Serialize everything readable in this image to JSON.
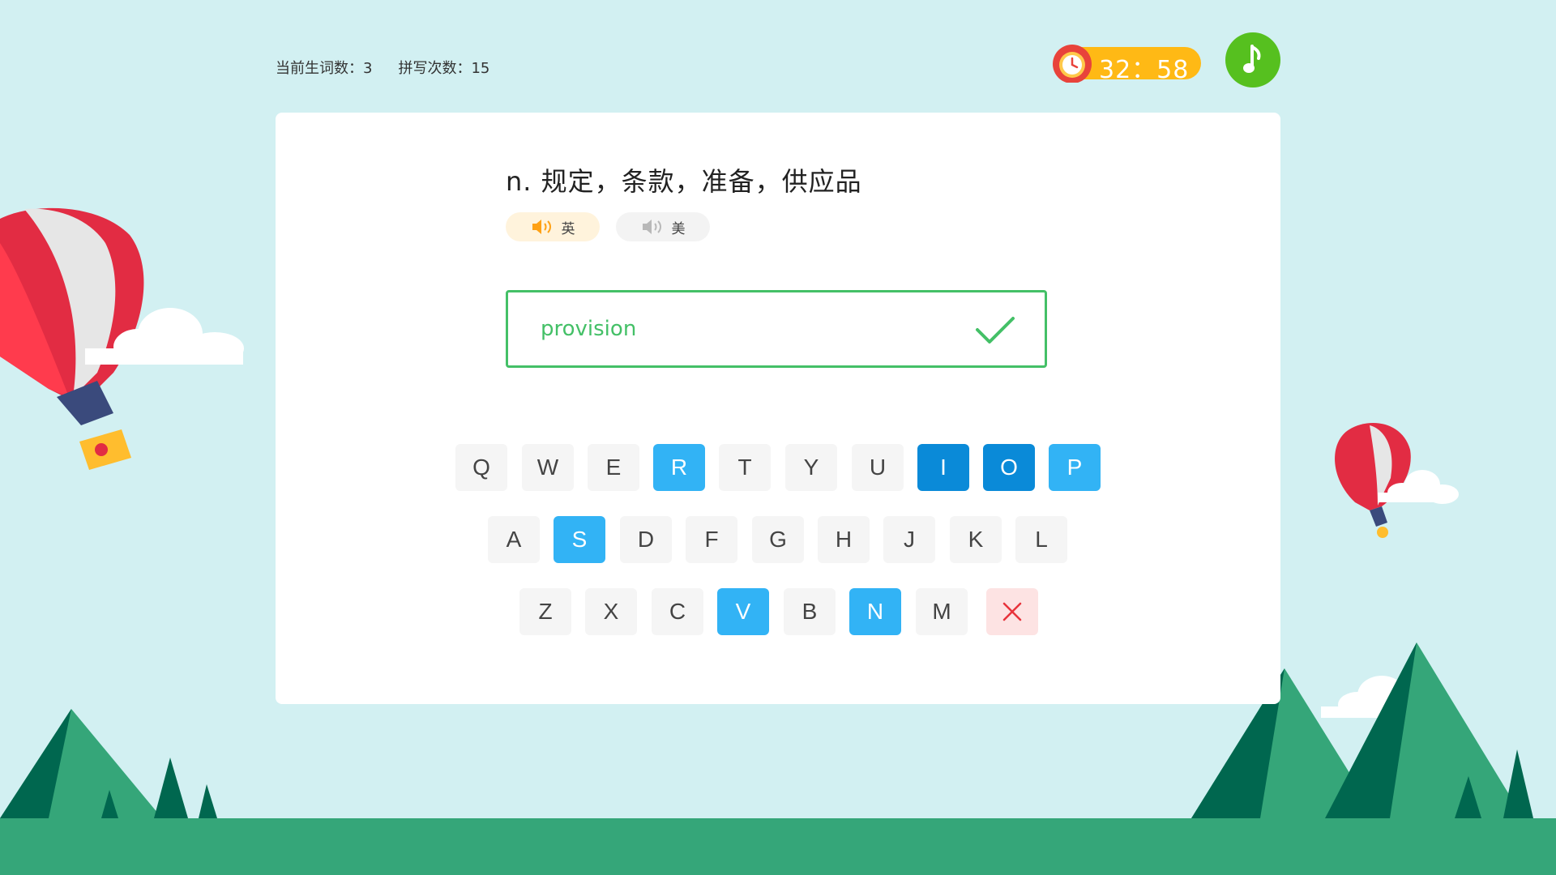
{
  "stats": {
    "new_words": "当前生词数：3",
    "spell_count": "拼写次数：15"
  },
  "timer": {
    "text": "32：58",
    "icon": "alarm-clock-icon"
  },
  "music": {
    "icon": "music-note-icon"
  },
  "word": {
    "definition": "n. 规定，条款，准备，供应品",
    "pron_uk": "英",
    "pron_us": "美"
  },
  "answer": {
    "value": "provision",
    "status_icon": "check-icon"
  },
  "keyboard": {
    "row1": [
      "Q",
      "W",
      "E",
      "R",
      "T",
      "Y",
      "U",
      "I",
      "O",
      "P"
    ],
    "row2": [
      "A",
      "S",
      "D",
      "F",
      "G",
      "H",
      "J",
      "K",
      "L"
    ],
    "row3": [
      "Z",
      "X",
      "C",
      "V",
      "B",
      "N",
      "M"
    ],
    "delete_icon": "close-icon"
  },
  "colors": {
    "background": "#d2f0f2",
    "correct": "#44c067",
    "key_used": "#32b3f5",
    "key_used_dark": "#0a8ad8",
    "timer": "#ffb915",
    "music": "#56c01f",
    "ground": "#35a679"
  }
}
